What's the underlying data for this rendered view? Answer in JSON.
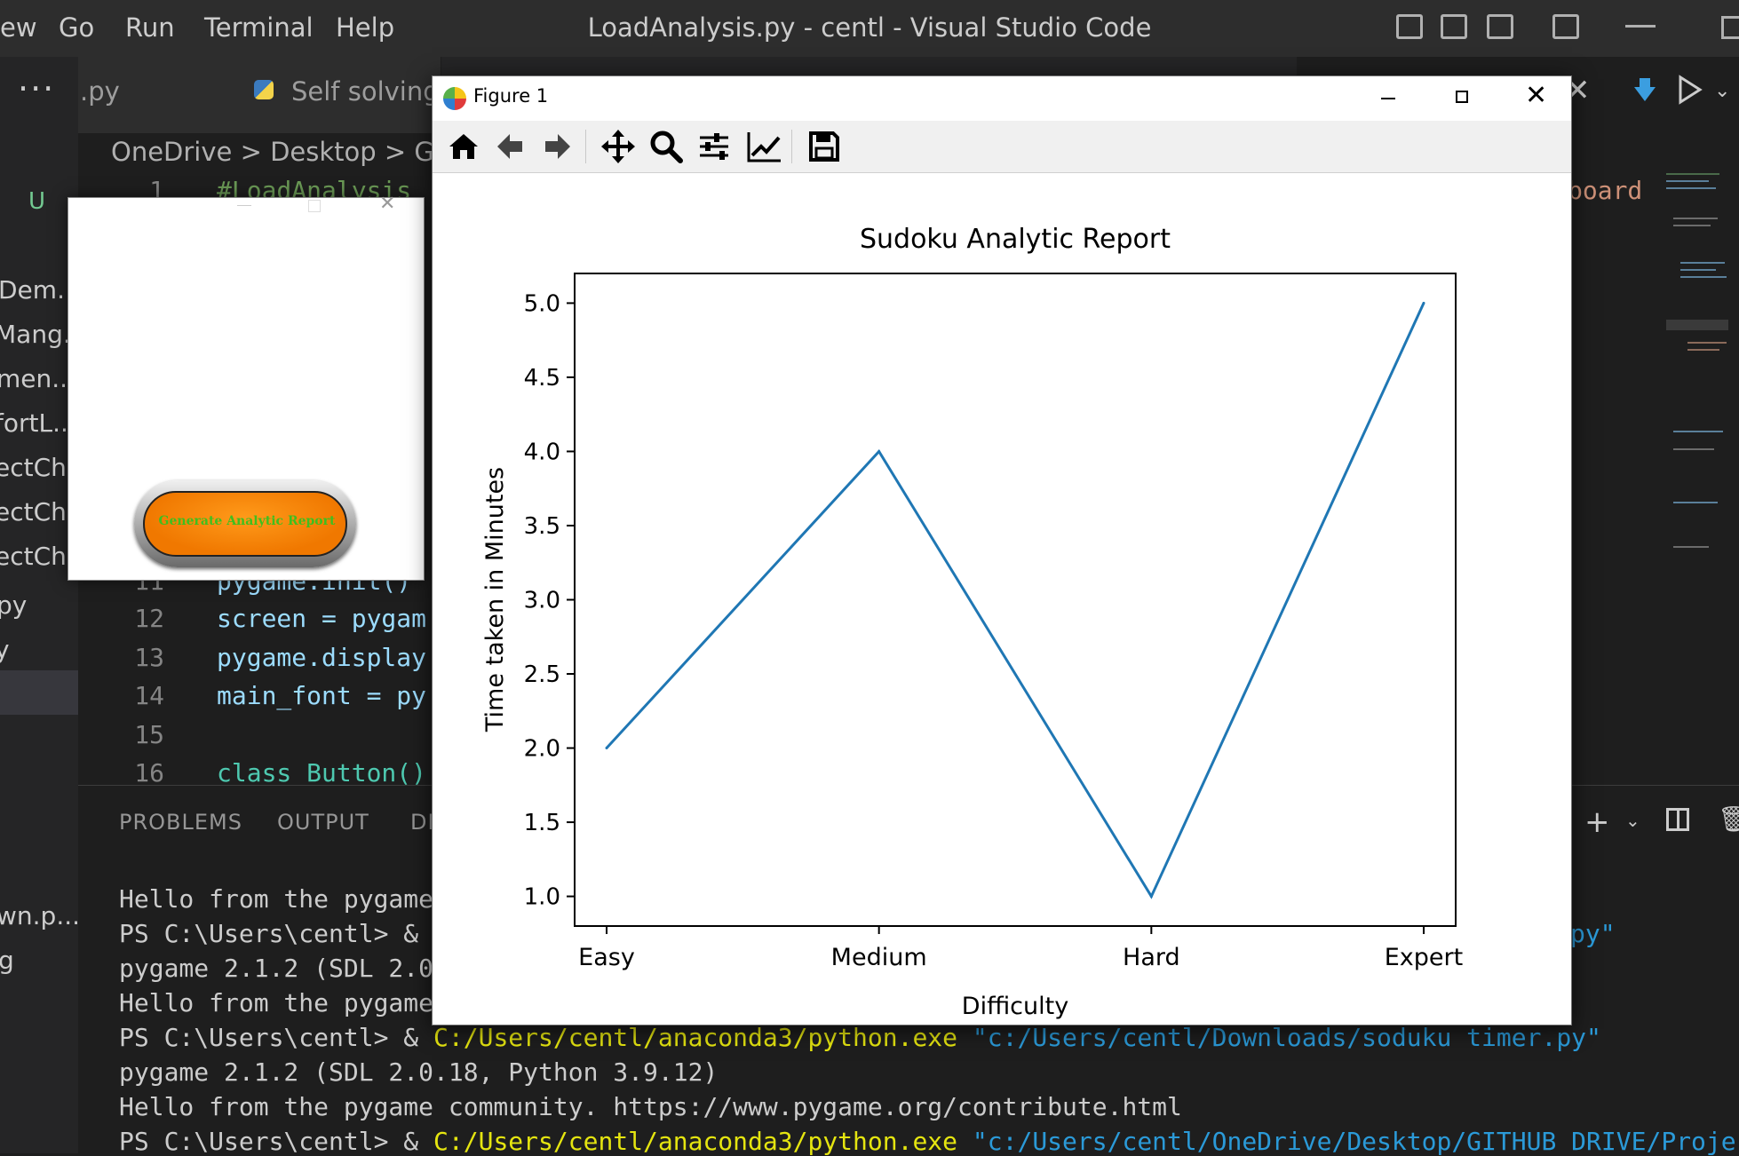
{
  "menu": {
    "view_partial": "ew",
    "go": "Go",
    "run": "Run",
    "terminal": "Terminal",
    "help": "Help"
  },
  "window": {
    "title": "LoadAnalysis.py - centl - Visual Studio Code"
  },
  "tabs": [
    {
      "label": ".py"
    },
    {
      "label": "Self solving"
    }
  ],
  "breadcrumb": "OneDrive > Desktop > GITH",
  "sidebar": {
    "status_letter": "U",
    "items": [
      "Dem...",
      "Mang...",
      "men...",
      "fortL...",
      "ectCh...",
      "ectCh...",
      "ectCh...",
      "py",
      "y",
      "wn.p...",
      "g"
    ]
  },
  "editor": {
    "lines": [
      {
        "no": "1",
        "text": "#LoadAnalysis"
      },
      {
        "no": "11",
        "text": "pygame.init()"
      },
      {
        "no": "12",
        "text": "screen = pygam"
      },
      {
        "no": "13",
        "text": "pygame.display"
      },
      {
        "no": "14",
        "text": "main_font = py"
      },
      {
        "no": "15",
        "text": ""
      },
      {
        "no": "16",
        "text": "class Button()"
      }
    ],
    "right_fragment": "board"
  },
  "panel": {
    "tabs": [
      "PROBLEMS",
      "OUTPUT",
      "DE"
    ],
    "terminal": [
      {
        "a": "Hello from the pygame",
        "b": "",
        "c": ""
      },
      {
        "a": "PS C:\\Users\\centl> & ",
        "b": "",
        "c": "py\""
      },
      {
        "a": "pygame 2.1.2 (SDL 2.0",
        "b": "",
        "c": ""
      },
      {
        "a": "Hello from the pygame",
        "b": "",
        "c": ""
      },
      {
        "a": "PS C:\\Users\\centl> & ",
        "b": "C:/Users/centl/anaconda3/python.exe",
        "c": " \"c:/Users/centl/Downloads/soduku timer.py\""
      },
      {
        "a": "pygame 2.1.2 (SDL 2.0.18, Python 3.9.12)",
        "b": "",
        "c": ""
      },
      {
        "a": "Hello from the pygame community. https://www.pygame.org/contribute.html",
        "b": "",
        "c": ""
      },
      {
        "a": "PS C:\\Users\\centl> & ",
        "b": "C:/Users/centl/anaconda3/python.exe",
        "c": " \"c:/Users/centl/OneDrive/Desktop/GITHUB DRIVE/Proje"
      }
    ]
  },
  "pygame_window": {
    "button_label": "Generate Analytic Report"
  },
  "figure_window": {
    "title": "Figure 1",
    "toolbar": [
      "home-icon",
      "back-icon",
      "forward-icon",
      "pan-icon",
      "zoom-icon",
      "configure-subplots-icon",
      "edit-axis-icon",
      "save-icon"
    ]
  },
  "colors": {
    "vscode_bg": "#1e1e1e",
    "line_color": "#1f77b4",
    "button_orange": "#f07800",
    "button_text_green": "#3fbf1f"
  },
  "chart_data": {
    "type": "line",
    "title": "Sudoku Analytic Report",
    "xlabel": "Difficulty",
    "ylabel": "Time taken in Minutes",
    "categories": [
      "Easy",
      "Medium",
      "Hard",
      "Expert"
    ],
    "values": [
      2.0,
      4.0,
      1.0,
      5.0
    ],
    "ylim": [
      0.8,
      5.2
    ],
    "yticks": [
      "1.0",
      "1.5",
      "2.0",
      "2.5",
      "3.0",
      "3.5",
      "4.0",
      "4.5",
      "5.0"
    ],
    "grid": false
  }
}
